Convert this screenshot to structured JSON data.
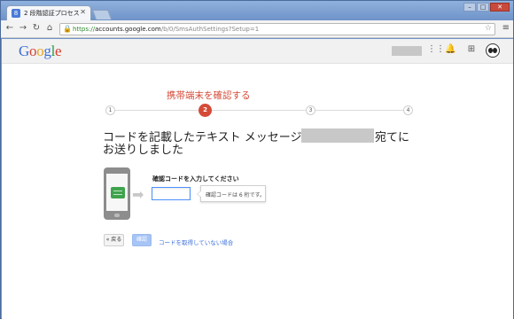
{
  "browser": {
    "tab_title": "2 段階認証プロセス",
    "tab_favicon": "8",
    "url_scheme": "https://",
    "url_host": "accounts.google.com",
    "url_path": "/b/0/SmsAuthSettings?Setup=1",
    "icons": [
      "back-icon",
      "forward-icon",
      "reload-icon",
      "home-icon",
      "lock-icon",
      "star-icon",
      "menu-icon"
    ]
  },
  "header": {
    "logo": {
      "G": "G",
      "o1": "o",
      "o2": "o",
      "g": "g",
      "l": "l",
      "e": "e"
    },
    "icons": [
      "apps-icon",
      "notifications-icon",
      "share-icon",
      "avatar"
    ]
  },
  "steps": {
    "title": "携帯端末を確認する",
    "items": [
      "1",
      "2",
      "3",
      "4"
    ],
    "active_index": 2
  },
  "main": {
    "heading_part1": "コードを記載したテキスト メッセージを",
    "heading_part2": "宛てに",
    "heading_line2": "お送りしました",
    "code_label": "確認コードを入力してください",
    "code_value": "",
    "tooltip": "確認コードは 6 桁です。",
    "back_button": "« 戻る",
    "confirm_button": "確認",
    "no_code_link": "コードを取得していない場合"
  },
  "colors": {
    "accent_red": "#d44b38",
    "link_blue": "#3b6fd8",
    "message_green": "#3fa34d"
  }
}
